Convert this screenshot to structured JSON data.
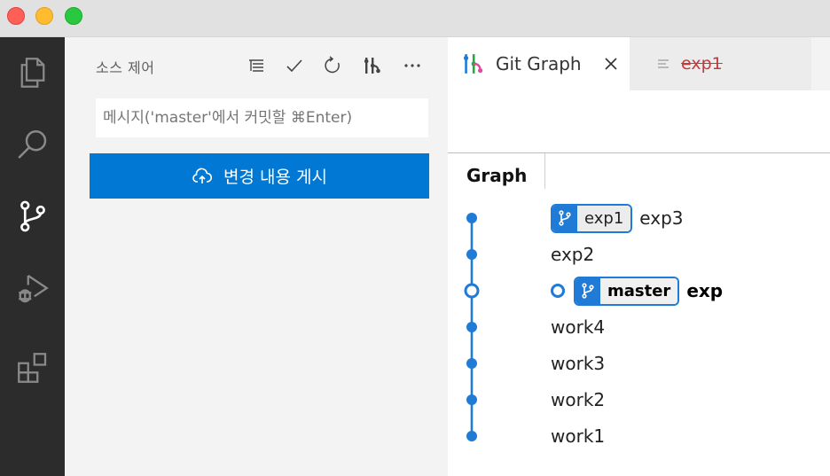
{
  "sidebar": {
    "title": "소스 제어",
    "commit_placeholder": "메시지('master'에서 커밋할 ⌘Enter)",
    "commit_button_label": "변경 내용 게시"
  },
  "tabs": {
    "active_label": "Git Graph",
    "inactive_label": "exp1"
  },
  "graph": {
    "column_header": "Graph",
    "commits": [
      {
        "message": "exp3",
        "branch": "exp1",
        "head": false
      },
      {
        "message": "exp2"
      },
      {
        "message": "exp",
        "branch": "master",
        "head": true
      },
      {
        "message": "work4"
      },
      {
        "message": "work3"
      },
      {
        "message": "work2"
      },
      {
        "message": "work1"
      }
    ]
  },
  "colors": {
    "accent": "#0078d4",
    "graph_line": "#1f7bd6",
    "activity_bar": "#2c2c2c",
    "sidebar_bg": "#f3f3f3"
  }
}
